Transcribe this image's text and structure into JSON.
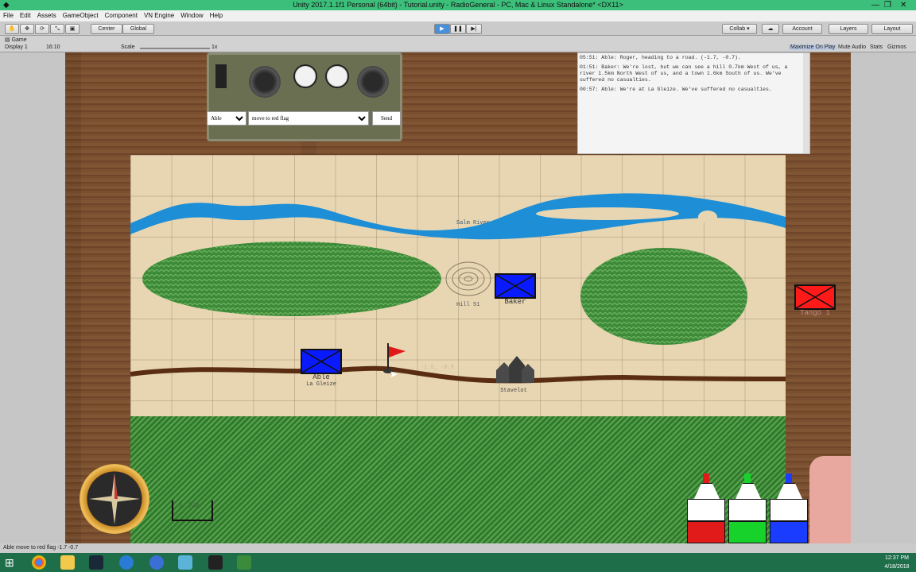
{
  "window": {
    "title": "Unity 2017.1.1f1 Personal (64bit) - Tutorial.unity - RadioGeneral - PC, Mac & Linux Standalone* <DX11>"
  },
  "menu": [
    "File",
    "Edit",
    "Assets",
    "GameObject",
    "Component",
    "VN Engine",
    "Window",
    "Help"
  ],
  "toolbar": {
    "center_label": "Center",
    "global_label": "Global",
    "collab_label": "Collab ▾",
    "account_label": "Account",
    "layers_label": "Layers",
    "layout_label": "Layout"
  },
  "game_view": {
    "tab_label": "Game",
    "display_label": "Display 1",
    "aspect_label": "16:10",
    "scale_label": "Scale",
    "scale_value": "1x",
    "maximize_label": "Maximize On Play",
    "mute_label": "Mute Audio",
    "stats_label": "Stats",
    "gizmos_label": "Gizmos"
  },
  "radio": {
    "unit_select": "Able",
    "order_select": "move to red flag",
    "send_label": "Send"
  },
  "log": {
    "entries": [
      "05:51: Able: Roger, heading to a road. (-1.7, -0.7).",
      "01:51: Baker: We're lost, but we can see a hill 0.7km West of us, a river 1.5km North West of us, and a town 1.6km South of us. We've suffered no casualties.",
      "00:57: Able: We're at La Gleize. We've suffered no casualties."
    ]
  },
  "map": {
    "river_label": "Salm River",
    "hill_label": "Hill 51",
    "town_label": "Stavelot",
    "able_location_label": "La Gleize",
    "flag_coords": "-1.6, -0.8",
    "scale_label": "1 Km",
    "units": [
      {
        "name": "Baker",
        "color": "#0a1aff"
      },
      {
        "name": "Able",
        "color": "#0a1aff"
      },
      {
        "name": "Tango 1",
        "color": "#ff1a1a"
      }
    ]
  },
  "markers": [
    {
      "color": "#e11a1a"
    },
    {
      "color": "#16d22a"
    },
    {
      "color": "#1a3cff"
    }
  ],
  "status_bar": {
    "message": "Able move to red flag -1.7 -0.7"
  },
  "taskbar": {
    "time": "12:37 PM",
    "date": "4/18/2018"
  }
}
